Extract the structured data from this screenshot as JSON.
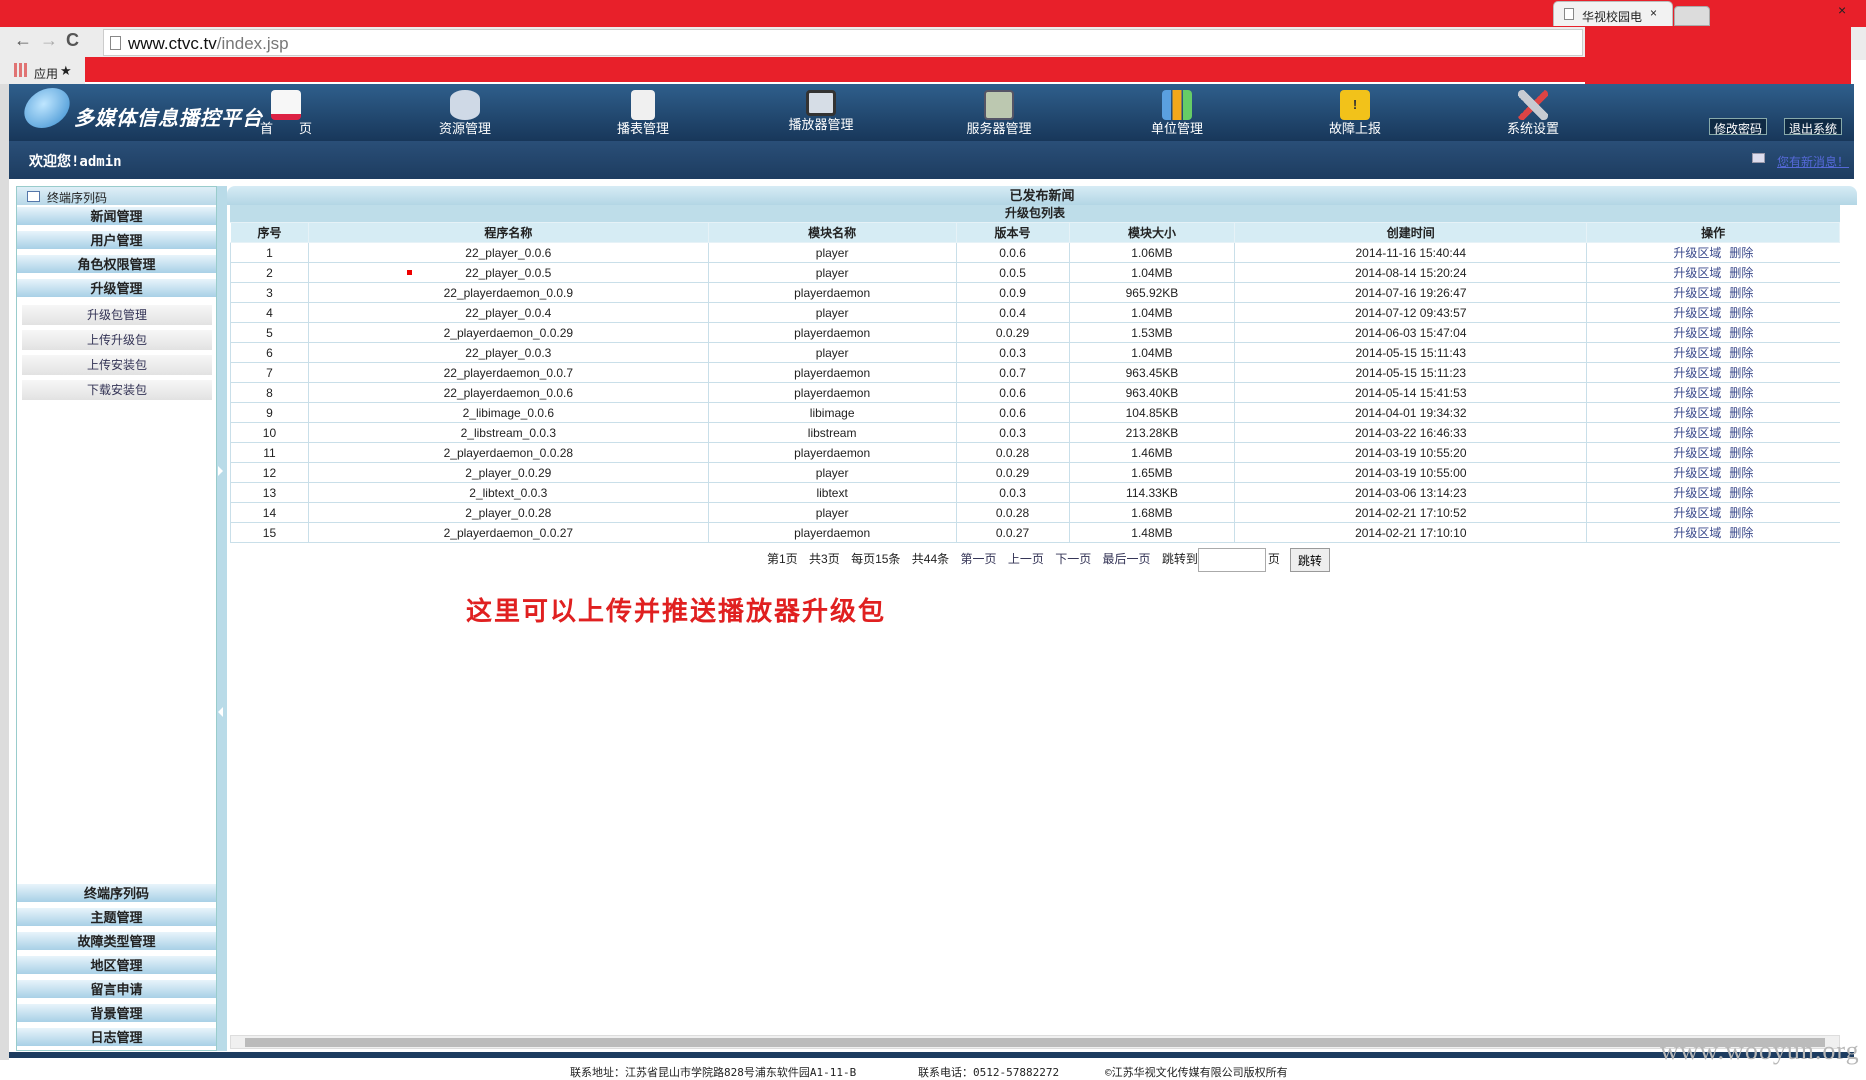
{
  "browser": {
    "tab_title": "华视校园电",
    "tab_close": "×",
    "window_close": "×",
    "url_host": "www.ctvc.tv",
    "url_path": "/index.jsp",
    "apps_label": "应用",
    "star": "★",
    "nav": {
      "back": "←",
      "forward": "→",
      "reload": "C"
    }
  },
  "header": {
    "logo_text": "多媒体信息播控平台",
    "nav_items": [
      {
        "label": "首　　页",
        "icon": "home-icon",
        "color": "#f7f7f7"
      },
      {
        "label": "资源管理",
        "icon": "database-icon",
        "color": "#cfd9e6"
      },
      {
        "label": "播表管理",
        "icon": "document-icon",
        "color": "#f0f0f0"
      },
      {
        "label": "播放器管理",
        "icon": "monitor-icon",
        "color": "#d6dde6"
      },
      {
        "label": "服务器管理",
        "icon": "server-icon",
        "color": "#bcc8b0"
      },
      {
        "label": "单位管理",
        "icon": "bar-chart-icon",
        "color": "#5aa0e0"
      },
      {
        "label": "故障上报",
        "icon": "warning-icon",
        "color": "#f2c21a"
      },
      {
        "label": "系统设置",
        "icon": "tools-icon",
        "color": "#c7cbd2"
      }
    ],
    "change_password": "修改密码",
    "logout": "退出系统"
  },
  "welcome": {
    "text": "欢迎您!admin",
    "new_message": "您有新消息！"
  },
  "sidebar": {
    "title": "终端序列码",
    "top_menus": [
      "新闻管理",
      "用户管理",
      "角色权限管理",
      "升级管理"
    ],
    "sub_items": [
      "升级包管理",
      "上传升级包",
      "上传安装包",
      "下载安装包"
    ],
    "bottom_menus": [
      "终端序列码",
      "主题管理",
      "故障类型管理",
      "地区管理",
      "留言申请",
      "背景管理",
      "日志管理"
    ]
  },
  "main": {
    "title": "已发布新闻",
    "list_title": "升级包列表",
    "columns": [
      "序号",
      "程序名称",
      "模块名称",
      "版本号",
      "模块大小",
      "创建时间",
      "操作"
    ],
    "op_labels": {
      "area": "升级区域",
      "delete": "删除"
    },
    "rows": [
      {
        "no": "1",
        "name": "22_player_0.0.6",
        "module": "player",
        "version": "0.0.6",
        "size": "1.06MB",
        "created": "2014-11-16 15:40:44"
      },
      {
        "no": "2",
        "name": "22_player_0.0.5",
        "module": "player",
        "version": "0.0.5",
        "size": "1.04MB",
        "created": "2014-08-14 15:20:24"
      },
      {
        "no": "3",
        "name": "22_playerdaemon_0.0.9",
        "module": "playerdaemon",
        "version": "0.0.9",
        "size": "965.92KB",
        "created": "2014-07-16 19:26:47"
      },
      {
        "no": "4",
        "name": "22_player_0.0.4",
        "module": "player",
        "version": "0.0.4",
        "size": "1.04MB",
        "created": "2014-07-12 09:43:57"
      },
      {
        "no": "5",
        "name": "2_playerdaemon_0.0.29",
        "module": "playerdaemon",
        "version": "0.0.29",
        "size": "1.53MB",
        "created": "2014-06-03 15:47:04"
      },
      {
        "no": "6",
        "name": "22_player_0.0.3",
        "module": "player",
        "version": "0.0.3",
        "size": "1.04MB",
        "created": "2014-05-15 15:11:43"
      },
      {
        "no": "7",
        "name": "22_playerdaemon_0.0.7",
        "module": "playerdaemon",
        "version": "0.0.7",
        "size": "963.45KB",
        "created": "2014-05-15 15:11:23"
      },
      {
        "no": "8",
        "name": "22_playerdaemon_0.0.6",
        "module": "playerdaemon",
        "version": "0.0.6",
        "size": "963.40KB",
        "created": "2014-05-14 15:41:53"
      },
      {
        "no": "9",
        "name": "2_libimage_0.0.6",
        "module": "libimage",
        "version": "0.0.6",
        "size": "104.85KB",
        "created": "2014-04-01 19:34:32"
      },
      {
        "no": "10",
        "name": "2_libstream_0.0.3",
        "module": "libstream",
        "version": "0.0.3",
        "size": "213.28KB",
        "created": "2014-03-22 16:46:33"
      },
      {
        "no": "11",
        "name": "2_playerdaemon_0.0.28",
        "module": "playerdaemon",
        "version": "0.0.28",
        "size": "1.46MB",
        "created": "2014-03-19 10:55:20"
      },
      {
        "no": "12",
        "name": "2_player_0.0.29",
        "module": "player",
        "version": "0.0.29",
        "size": "1.65MB",
        "created": "2014-03-19 10:55:00"
      },
      {
        "no": "13",
        "name": "2_libtext_0.0.3",
        "module": "libtext",
        "version": "0.0.3",
        "size": "114.33KB",
        "created": "2014-03-06 13:14:23"
      },
      {
        "no": "14",
        "name": "2_player_0.0.28",
        "module": "player",
        "version": "0.0.28",
        "size": "1.68MB",
        "created": "2014-02-21 17:10:52"
      },
      {
        "no": "15",
        "name": "2_playerdaemon_0.0.27",
        "module": "playerdaemon",
        "version": "0.0.27",
        "size": "1.48MB",
        "created": "2014-02-21 17:10:10"
      }
    ],
    "pager": {
      "current": "第1页",
      "total_pages": "共3页",
      "per_page": "每页15条",
      "total": "共44条",
      "first": "第一页",
      "prev": "上一页",
      "next": "下一页",
      "last": "最后一页",
      "jump_to": "跳转到",
      "page_unit": "页",
      "go": "跳转"
    },
    "annotation": "这里可以上传并推送播放器升级包"
  },
  "footer": {
    "address": "联系地址：江苏省昆山市学院路828号浦东软件园A1-11-B",
    "phone": "联系电话：0512-57882272",
    "copyright": "©江苏华视文化传媒有限公司版权所有"
  },
  "watermark": "www.wooyun.org"
}
